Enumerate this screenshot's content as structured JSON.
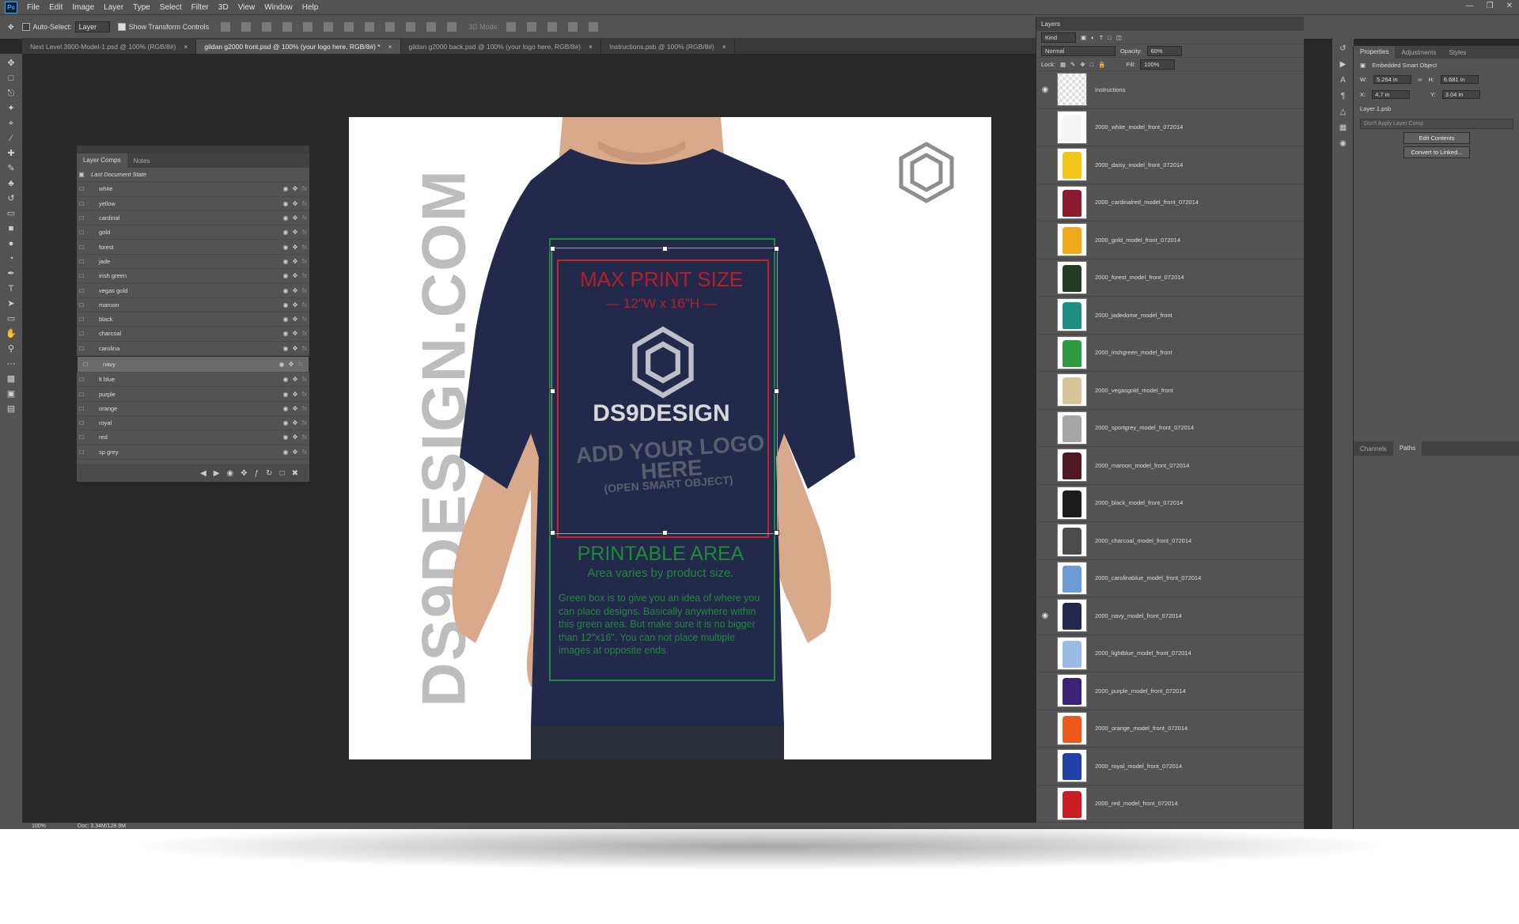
{
  "app": {
    "logo": "Ps"
  },
  "menu": [
    "File",
    "Edit",
    "Image",
    "Layer",
    "Type",
    "Select",
    "Filter",
    "3D",
    "View",
    "Window",
    "Help"
  ],
  "options": {
    "auto_select": "Auto-Select:",
    "target": "Layer",
    "show_transform": "Show Transform Controls",
    "mode_3d": "3D Mode:"
  },
  "doc_tabs": [
    {
      "label": "Next Level 3900-Model-1.psd @ 100% (RGB/8#)",
      "close": "×"
    },
    {
      "label": "gildan g2000 front.psd @ 100% (your logo here, RGB/8#) *",
      "close": "×"
    },
    {
      "label": "gildan g2000 back.psd @ 100% (your logo here, RGB/8#)",
      "close": "×"
    },
    {
      "label": "Instructions.psb @ 100% (RGB/8#)",
      "close": "×"
    }
  ],
  "canvas": {
    "vertical_text": "DS9DESIGN.COM",
    "max_print": "MAX PRINT SIZE",
    "dims": "— 12\"W x 16\"H —",
    "brand": "DS9DESIGN",
    "add_logo": "ADD YOUR LOGO HERE",
    "add_logo_sub": "(OPEN SMART OBJECT)",
    "printable": "PRINTABLE AREA",
    "varies": "Area varies by product size.",
    "note": "Green box is to give you an idea of where you can place designs. Basically anywhere within this green area. But make sure it is no bigger than 12\"x16\". You can not place multiple images at opposite ends.",
    "shirt_color": "#23294a",
    "green": "#1f8a3a",
    "red": "#c4252d"
  },
  "layer_comps": {
    "tabs": [
      "Layer Comps",
      "Notes"
    ],
    "last_state": "Last Document State",
    "items": [
      "white",
      "yellow",
      "cardinal",
      "gold",
      "forest",
      "jade",
      "irish green",
      "vegas gold",
      "maroon",
      "black",
      "charcoal",
      "carolina",
      "navy",
      "lt blue",
      "purple",
      "orange",
      "royal",
      "red",
      "sp grey"
    ],
    "selected": "navy"
  },
  "layers": {
    "title": "Layers",
    "kind": "Kind",
    "blend": "Normal",
    "opacity_label": "Opacity:",
    "opacity": "60%",
    "lock_label": "Lock:",
    "fill_label": "Fill:",
    "fill": "100%",
    "items": [
      {
        "name": "Instructions",
        "visible": true,
        "color": "transparent"
      },
      {
        "name": "2000_white_model_front_072014",
        "visible": false,
        "color": "#f4f4f4"
      },
      {
        "name": "2000_daisy_model_front_072014",
        "visible": false,
        "color": "#f3c518"
      },
      {
        "name": "2000_cardinalred_model_front_072014",
        "visible": false,
        "color": "#8c1a2e"
      },
      {
        "name": "2000_gold_model_front_072014",
        "visible": false,
        "color": "#f0a91b"
      },
      {
        "name": "2000_forest_model_front_072014",
        "visible": false,
        "color": "#243a24"
      },
      {
        "name": "2000_jadedome_model_front",
        "visible": false,
        "color": "#1f8f86"
      },
      {
        "name": "2000_irishgreen_model_front",
        "visible": false,
        "color": "#2e9a44"
      },
      {
        "name": "2000_vegasgold_model_front",
        "visible": false,
        "color": "#d9c59a"
      },
      {
        "name": "2000_sportgrey_model_front_072014",
        "visible": false,
        "color": "#a6a6a6"
      },
      {
        "name": "2000_maroon_model_front_072014",
        "visible": false,
        "color": "#4f1a25"
      },
      {
        "name": "2000_black_model_front_072014",
        "visible": false,
        "color": "#1c1c1c"
      },
      {
        "name": "2000_charcoal_model_front_072014",
        "visible": false,
        "color": "#4b4b4b"
      },
      {
        "name": "2000_carolinablue_model_front_072014",
        "visible": false,
        "color": "#6c9bd8"
      },
      {
        "name": "2000_navy_model_front_072014",
        "visible": true,
        "color": "#23294a"
      },
      {
        "name": "2000_lightblue_model_front_072014",
        "visible": false,
        "color": "#9bbbe5"
      },
      {
        "name": "2000_purple_model_front_072014",
        "visible": false,
        "color": "#3b2277"
      },
      {
        "name": "2000_orange_model_front_072014",
        "visible": false,
        "color": "#ef5a1c"
      },
      {
        "name": "2000_royal_model_front_072014",
        "visible": false,
        "color": "#2141a8"
      },
      {
        "name": "2000_red_model_front_072014",
        "visible": false,
        "color": "#c81d25"
      }
    ]
  },
  "properties": {
    "tabs": [
      "Properties",
      "Adjustments",
      "Styles"
    ],
    "kind": "Embedded Smart Object",
    "w_label": "W:",
    "w": "5.264 in",
    "h_label": "H:",
    "h": "6.681 in",
    "x_label": "X:",
    "x": "4.7 in",
    "y_label": "Y:",
    "y": "3.04 in",
    "link": "Layer 1.psb",
    "comp": "Don't Apply Layer Comp",
    "edit_btn": "Edit Contents",
    "convert_btn": "Convert to Linked...",
    "lower_tabs": [
      "Channels",
      "Paths"
    ]
  },
  "status": {
    "zoom": "100%",
    "doc": "Doc: 3.34M/128.9M"
  }
}
